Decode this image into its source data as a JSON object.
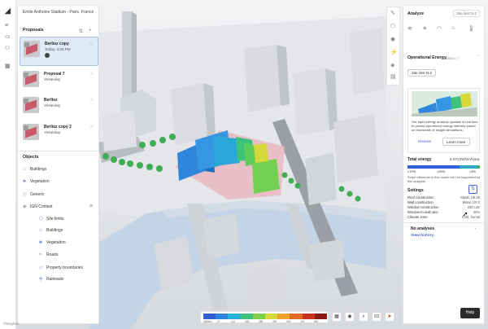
{
  "project": {
    "title": "Émile Anthoine Stadium - Paris, France"
  },
  "proposals": {
    "heading": "Proposals",
    "items": [
      {
        "name": "Berlioz copy",
        "sub": "Today, 3:26 PM",
        "selected": true
      },
      {
        "name": "Proposal 7",
        "sub": "Yesterday",
        "selected": false
      },
      {
        "name": "Berlioz",
        "sub": "Yesterday",
        "selected": false
      },
      {
        "name": "Berlioz copy 2",
        "sub": "Yesterday",
        "selected": false
      }
    ]
  },
  "objects": {
    "heading": "Objects",
    "items": [
      {
        "label": "Buildings",
        "icon": "building-icon"
      },
      {
        "label": "Vegetation",
        "icon": "tree-icon"
      },
      {
        "label": "Generic",
        "icon": "shape-icon"
      },
      {
        "label": "IGN Context",
        "icon": "layers-icon"
      }
    ],
    "context_items": [
      {
        "label": "Site limits",
        "icon": "site-limits-icon"
      },
      {
        "label": "Buildings",
        "icon": "building-icon"
      },
      {
        "label": "Vegetation",
        "icon": "tree-icon"
      },
      {
        "label": "Roads",
        "icon": "road-icon"
      },
      {
        "label": "Property boundaries",
        "icon": "boundary-icon"
      },
      {
        "label": "Railroads",
        "icon": "railroad-icon"
      }
    ]
  },
  "analyze": {
    "title": "Analyze",
    "site_selector": "Site limit N-2",
    "section_title": "Operational Energy",
    "section_version": "B3010 ⓘ",
    "site_chip": "Site limit N-2",
    "card": {
      "description": "Our rapid energy analysis updates in real time to predict operational energy intensity based on thousands of Insight simulations.",
      "dismiss": "Dismiss",
      "learn_more": "Learn more"
    },
    "total_energy_label": "Total energy",
    "total_energy_value": "4,070 kWh/m²/year",
    "distribution": [
      {
        "label": "≈72%",
        "fraction": 0.72,
        "color": "#2f63d6"
      },
      {
        "label": "≈25%",
        "fraction": 0.25,
        "color": "#2fa5c8"
      },
      {
        "label": "≈3%",
        "fraction": 0.03,
        "color": "#3ab25a"
      }
    ],
    "note": "Some elements in this model are not supported by this analysis.",
    "settings_label": "Settings",
    "settings": [
      {
        "label": "Roof construction",
        "value": "Metal, U0.35"
      },
      {
        "label": "Wall construction",
        "value": "Metal, U0.3"
      },
      {
        "label": "Window construction",
        "value": "Dbl LoE"
      },
      {
        "label": "Window-to-wall ratio",
        "value": "40%"
      },
      {
        "label": "Climate zone",
        "value": "Cold, humid"
      }
    ],
    "no_analyses": "No analyses",
    "view_history": "View history"
  },
  "legend": {
    "colors": [
      "#2f5fd0",
      "#2b86db",
      "#29b0d6",
      "#3cc27a",
      "#7fd14a",
      "#d6d93a",
      "#f0a22e",
      "#e26a26",
      "#c8321e",
      "#8c1a14"
    ],
    "labels": [
      "kWh/m²",
      "37",
      "110",
      "183",
      "256",
      "330",
      "403",
      "476",
      "549"
    ]
  },
  "toolbar": {
    "two_d": "2D",
    "help": "Help"
  },
  "watermark": "©Mapbox"
}
